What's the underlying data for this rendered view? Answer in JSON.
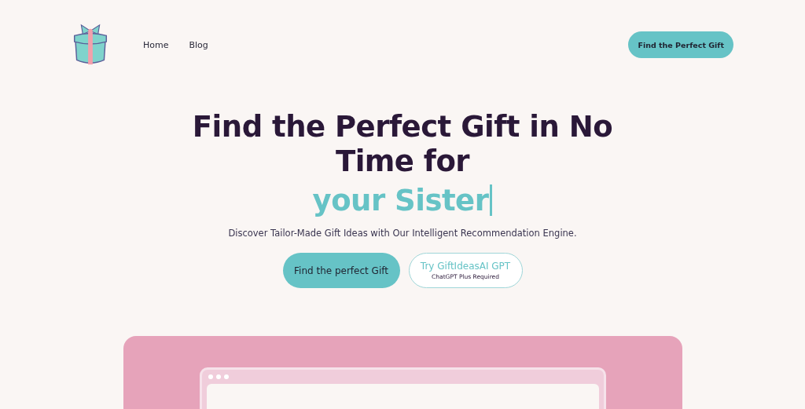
{
  "nav": {
    "links": [
      {
        "label": "Home"
      },
      {
        "label": "Blog"
      }
    ],
    "cta": "Find the Perfect Gift"
  },
  "hero": {
    "title": "Find the Perfect Gift in No Time for",
    "highlight": "your Sister",
    "cursor": true,
    "subtitle": "Discover Tailor-Made Gift Ideas with Our Intelligent Recommendation Engine.",
    "primary_button": "Find the perfect Gift",
    "secondary_button": {
      "label": "Try GiftIdeasAI GPT",
      "note": "ChatGPT Plus Required"
    }
  },
  "preview": {
    "kind": "browser-mockup"
  }
}
